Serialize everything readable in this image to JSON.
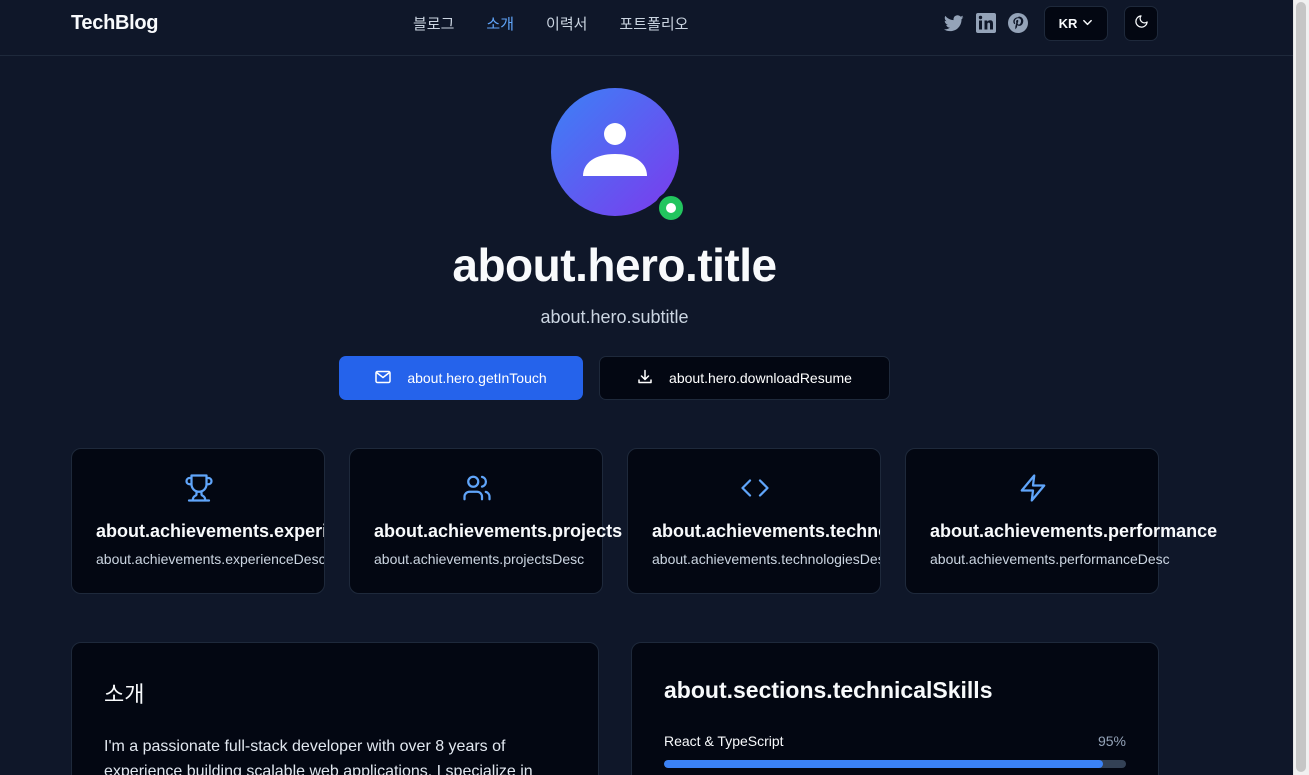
{
  "header": {
    "logo": "TechBlog",
    "nav": [
      {
        "label": "블로그"
      },
      {
        "label": "소개",
        "active": true
      },
      {
        "label": "이력서"
      },
      {
        "label": "포트폴리오"
      }
    ],
    "socials": [
      "twitter-icon",
      "linkedin-icon",
      "pinterest-icon"
    ],
    "language": "KR",
    "theme_icon": "moon-icon"
  },
  "hero": {
    "title": "about.hero.title",
    "subtitle": "about.hero.subtitle",
    "get_in_touch": "about.hero.getInTouch",
    "download_resume": "about.hero.downloadResume",
    "status": "online",
    "status_color": "#22c55e"
  },
  "achievements": [
    {
      "icon": "trophy-icon",
      "title": "about.achievements.experience",
      "desc": "about.achievements.experienceDesc"
    },
    {
      "icon": "users-icon",
      "title": "about.achievements.projects",
      "desc": "about.achievements.projectsDesc"
    },
    {
      "icon": "code-icon",
      "title": "about.achievements.technologies",
      "desc": "about.achievements.technologiesDesc"
    },
    {
      "icon": "zap-icon",
      "title": "about.achievements.performance",
      "desc": "about.achievements.performanceDesc"
    }
  ],
  "about_section": {
    "title": "소개",
    "text": "I'm a passionate full-stack developer with over 8 years of experience building scalable web applications. I specialize in"
  },
  "skills_section": {
    "title": "about.sections.technicalSkills",
    "skills": [
      {
        "name": "React & TypeScript",
        "percent_label": "95%",
        "level": 0.95
      }
    ]
  },
  "colors": {
    "background": "#0f1729",
    "card": "#030712",
    "accent": "#3b82f6",
    "primary_button": "#2563eb"
  }
}
